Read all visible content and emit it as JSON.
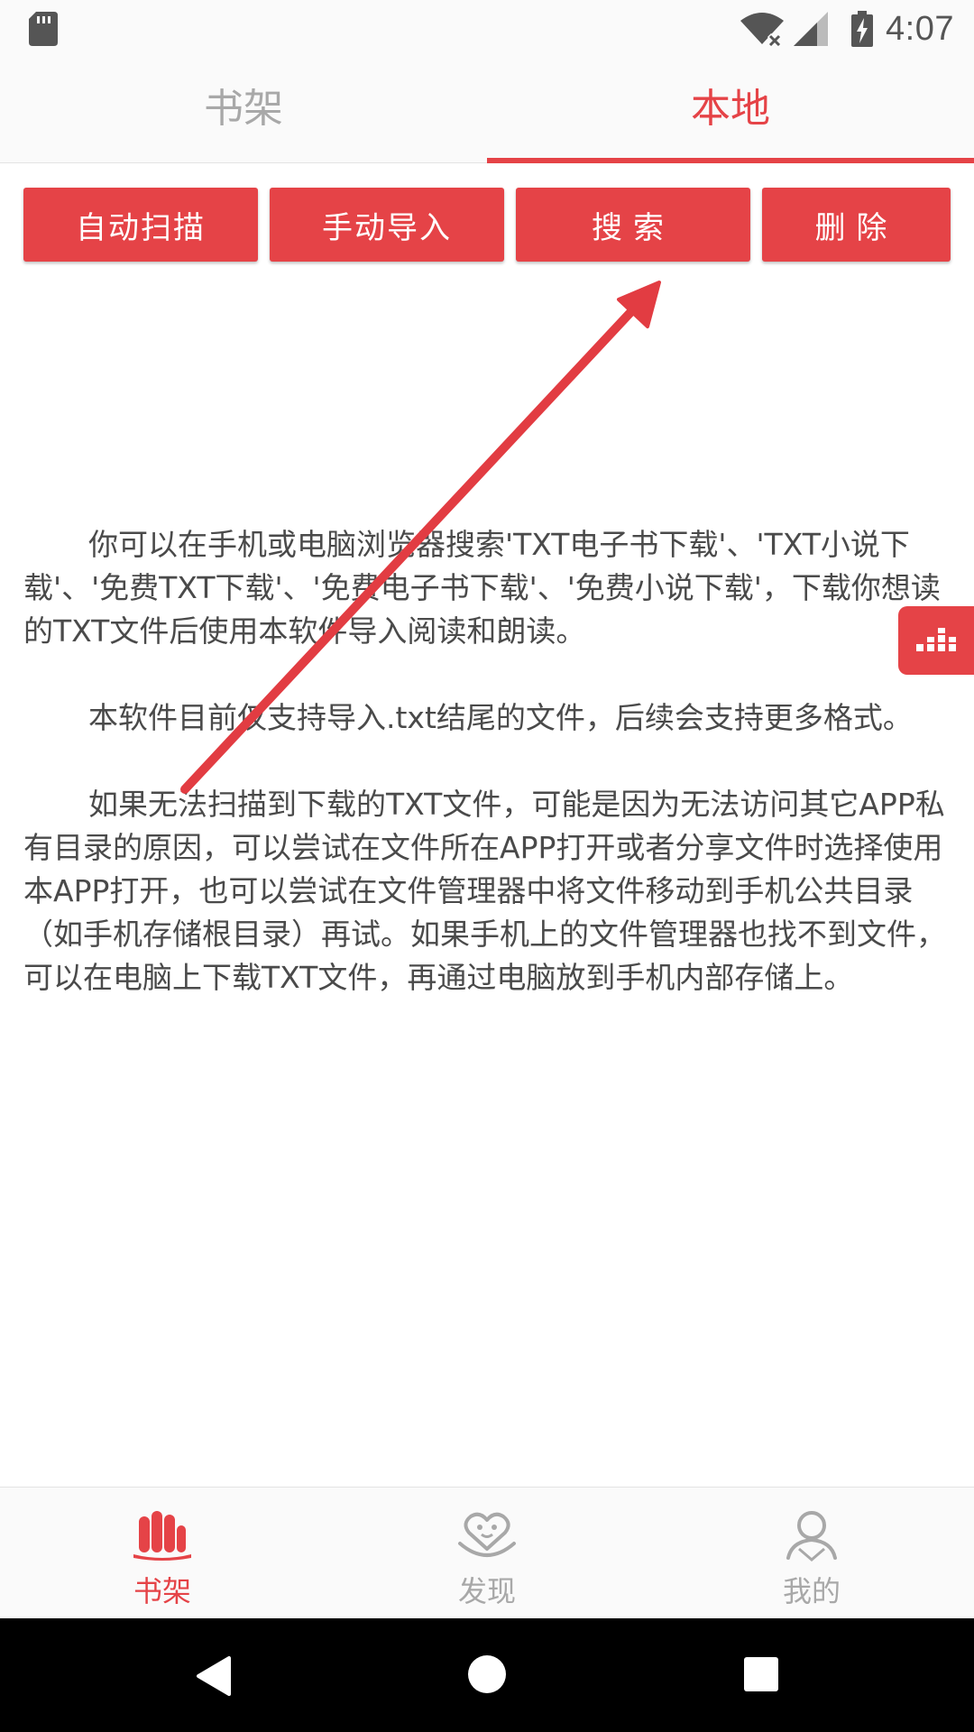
{
  "status_bar": {
    "time": "4:07",
    "icons": [
      "sd-card-icon",
      "wifi-icon",
      "signal-icon",
      "battery-charging-icon"
    ]
  },
  "tabs": [
    {
      "label": "书架",
      "active": false
    },
    {
      "label": "本地",
      "active": true
    }
  ],
  "actions": {
    "auto_scan": "自动扫描",
    "manual_import": "手动导入",
    "search": "搜索",
    "delete": "删除"
  },
  "info": {
    "paragraphs": [
      "你可以在手机或电脑浏览器搜索'TXT电子书下载'、'TXT小说下载'、'免费TXT下载'、'免费电子书下载'、'免费小说下载'，下载你想读的TXT文件后使用本软件导入阅读和朗读。",
      "本软件目前仅支持导入.txt结尾的文件，后续会支持更多格式。",
      "如果无法扫描到下载的TXT文件，可能是因为无法访问其它APP私有目录的原因，可以尝试在文件所在APP打开或者分享文件时选择使用本APP打开，也可以尝试在文件管理器中将文件移动到手机公共目录（如手机存储根目录）再试。如果手机上的文件管理器也找不到文件，可以在电脑上下载TXT文件，再通过电脑放到手机内部存储上。"
    ]
  },
  "floating_button": {
    "icon": "equalizer-icon"
  },
  "bottom_nav": [
    {
      "label": "书架",
      "icon": "bookshelf-icon",
      "active": true
    },
    {
      "label": "发现",
      "icon": "discover-icon",
      "active": false
    },
    {
      "label": "我的",
      "icon": "profile-icon",
      "active": false
    }
  ],
  "system_nav": {
    "icons": [
      "back-icon",
      "home-icon",
      "recents-icon"
    ]
  },
  "colors": {
    "accent": "#e54347",
    "text": "#4a4a4a",
    "inactive": "#a8a8a8",
    "background": "#ffffff"
  }
}
